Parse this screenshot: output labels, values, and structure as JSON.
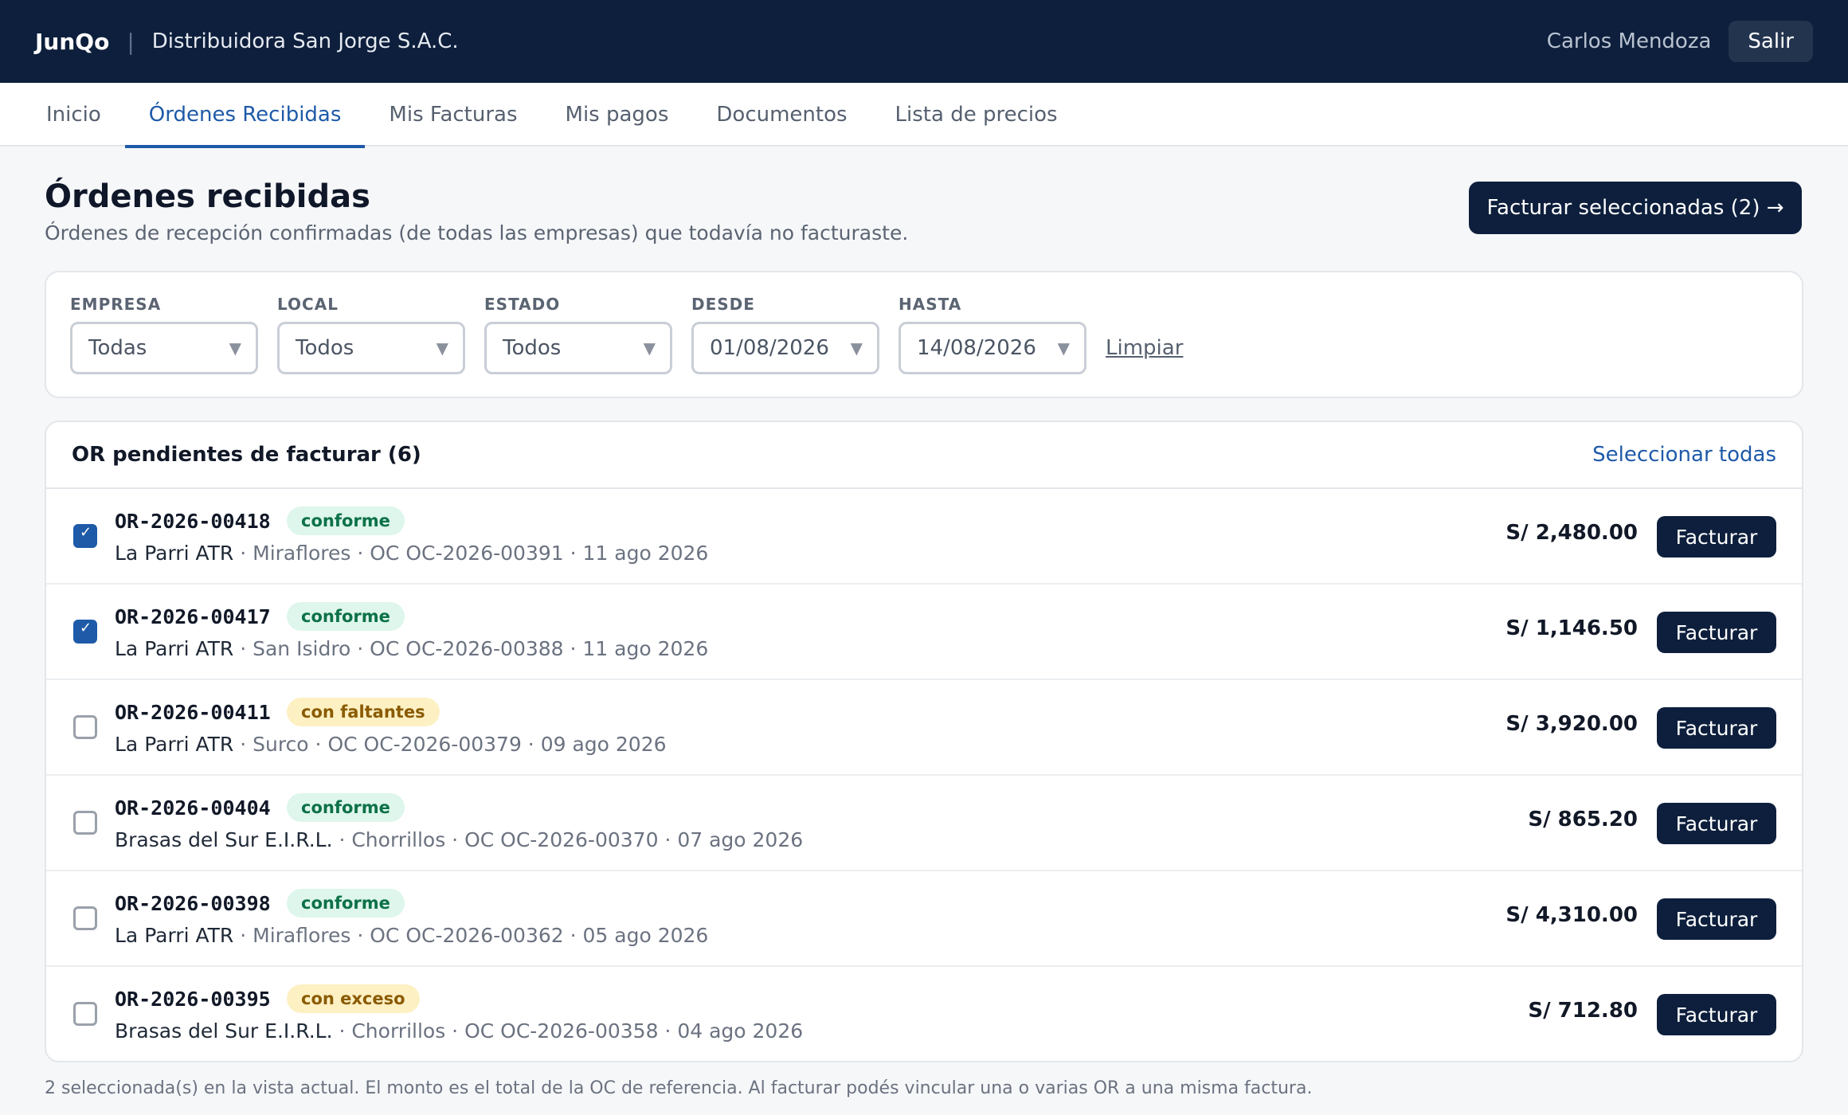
{
  "header": {
    "brand": "JunQo",
    "separator": "|",
    "company": "Distribuidora San Jorge S.A.C.",
    "user": "Carlos Mendoza",
    "logout_label": "Salir"
  },
  "tabs": [
    {
      "label": "Inicio"
    },
    {
      "label": "Órdenes Recibidas",
      "active": true
    },
    {
      "label": "Mis Facturas"
    },
    {
      "label": "Mis pagos"
    },
    {
      "label": "Documentos"
    },
    {
      "label": "Lista de precios"
    }
  ],
  "page": {
    "title": "Órdenes recibidas",
    "subtitle": "Órdenes de recepción confirmadas (de todas las empresas) que todavía no facturaste.",
    "primary_action": "Facturar seleccionadas (2) →"
  },
  "filters": {
    "empresa": {
      "label": "EMPRESA",
      "value": "Todas"
    },
    "local": {
      "label": "LOCAL",
      "value": "Todos"
    },
    "estado": {
      "label": "ESTADO",
      "value": "Todos"
    },
    "desde": {
      "label": "DESDE",
      "value": "01/08/2026"
    },
    "hasta": {
      "label": "HASTA",
      "value": "14/08/2026"
    },
    "clear_label": "Limpiar",
    "caret": "▼"
  },
  "list": {
    "title": "OR pendientes de facturar (6)",
    "select_all": "Seleccionar todas",
    "action_label": "Facturar",
    "rows": [
      {
        "code": "OR-2026-00418",
        "status": "conforme",
        "client": "La Parri ATR",
        "details": " · Miraflores · OC OC-2026-00391 · 11 ago 2026",
        "amount": "S/ 2,480.00",
        "checked": true
      },
      {
        "code": "OR-2026-00417",
        "status": "conforme",
        "client": "La Parri ATR",
        "details": " · San Isidro · OC OC-2026-00388 · 11 ago 2026",
        "amount": "S/ 1,146.50",
        "checked": true
      },
      {
        "code": "OR-2026-00411",
        "status": "con faltantes",
        "client": "La Parri ATR",
        "details": " · Surco · OC OC-2026-00379 · 09 ago 2026",
        "amount": "S/ 3,920.00",
        "checked": false
      },
      {
        "code": "OR-2026-00404",
        "status": "conforme",
        "client": "Brasas del Sur E.I.R.L.",
        "details": " · Chorrillos · OC OC-2026-00370 · 07 ago 2026",
        "amount": "S/ 865.20",
        "checked": false
      },
      {
        "code": "OR-2026-00398",
        "status": "conforme",
        "client": "La Parri ATR",
        "details": " · Miraflores · OC OC-2026-00362 · 05 ago 2026",
        "amount": "S/ 4,310.00",
        "checked": false
      },
      {
        "code": "OR-2026-00395",
        "status": "con exceso",
        "client": "Brasas del Sur E.I.R.L.",
        "details": " · Chorrillos · OC OC-2026-00358 · 04 ago 2026",
        "amount": "S/ 712.80",
        "checked": false
      }
    ]
  },
  "footnote": "2 seleccionada(s) en la vista actual. El monto es el total de la OC de referencia. Al facturar podés vincular una o varias OR a una misma factura."
}
